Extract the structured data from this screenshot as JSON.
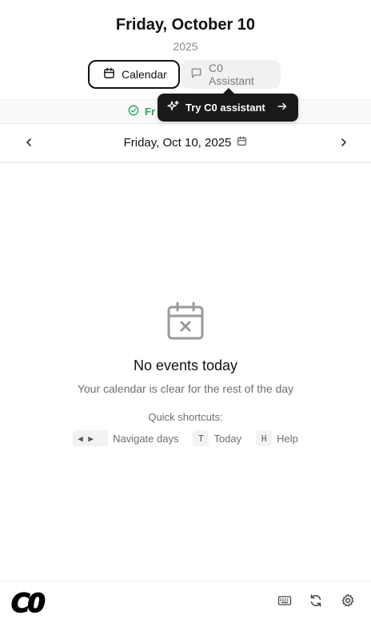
{
  "header": {
    "title": "Friday, October 10",
    "year": "2025"
  },
  "tabs": [
    {
      "label": "Calendar",
      "icon": "calendar-icon",
      "active": true
    },
    {
      "label": "C0 Assistant",
      "icon": "chat-bubble-icon",
      "active": false
    }
  ],
  "status": {
    "text": "Fr",
    "icon": "check-circle-icon",
    "color": "#22a559"
  },
  "tooltip": {
    "label": "Try C0 assistant",
    "icon": "sparkles-icon",
    "trailing_icon": "arrow-right-icon"
  },
  "date_nav": {
    "date_label": "Friday, Oct 10, 2025",
    "prev_icon": "chevron-left-icon",
    "next_icon": "chevron-right-icon",
    "date_icon": "calendar-icon"
  },
  "empty_state": {
    "icon": "calendar-x-icon",
    "title": "No events today",
    "subtitle": "Your calendar is clear for the rest of the day",
    "shortcuts_title": "Quick shortcuts:",
    "shortcuts": [
      {
        "keys": "◀ ▶",
        "label": "Navigate days"
      },
      {
        "keys": "T",
        "label": "Today"
      },
      {
        "keys": "H",
        "label": "Help"
      }
    ]
  },
  "footer": {
    "logo": "C0",
    "icons": [
      "keyboard-icon",
      "refresh-icon",
      "settings-icon"
    ]
  },
  "colors": {
    "accent_dark": "#111111",
    "muted_text": "#6f6f6f",
    "success": "#22a559",
    "tooltip_bg": "#1a1a1a"
  }
}
